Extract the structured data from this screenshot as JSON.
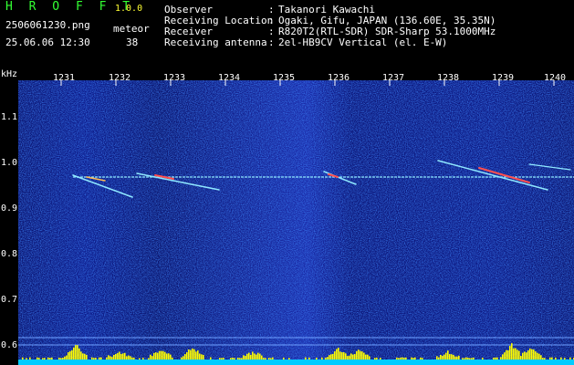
{
  "header": {
    "app_title": "H R O F F T",
    "app_version": "1.0.0",
    "file_name": "2506061230.png",
    "time_stamp": "25.06.06 12:30",
    "mode_label": "meteor",
    "count_value": "38",
    "info_rows": [
      {
        "label": "Observer",
        "value": "Takanori Kawachi"
      },
      {
        "label": "Receiving Location",
        "value": "Ogaki, Gifu, JAPAN (136.60E, 35.35N)"
      },
      {
        "label": "Receiver",
        "value": "R820T2(RTL-SDR) SDR-Sharp 53.1000MHz"
      },
      {
        "label": "Receiving antenna",
        "value": "2el-HB9CV Vertical (el. E-W)"
      }
    ],
    "colon": ":"
  },
  "axis": {
    "unit": "kHz",
    "y_ticks": [
      "1.1",
      "1.0",
      "0.9",
      "0.8",
      "0.7",
      "0.6"
    ],
    "x_ticks": [
      "1231",
      "1232",
      "1233",
      "1234",
      "1235",
      "1236",
      "1237",
      "1238",
      "1239",
      "1240"
    ]
  },
  "colors": {
    "header_green": "#33ff33",
    "header_yellow": "#ffff33",
    "background_noise": "#0a1a88",
    "signal_line": "#8fe8ff",
    "meteor_hot": "#ff5050",
    "activity_bar": "#ffff00",
    "baseline": "#00ccff"
  }
}
